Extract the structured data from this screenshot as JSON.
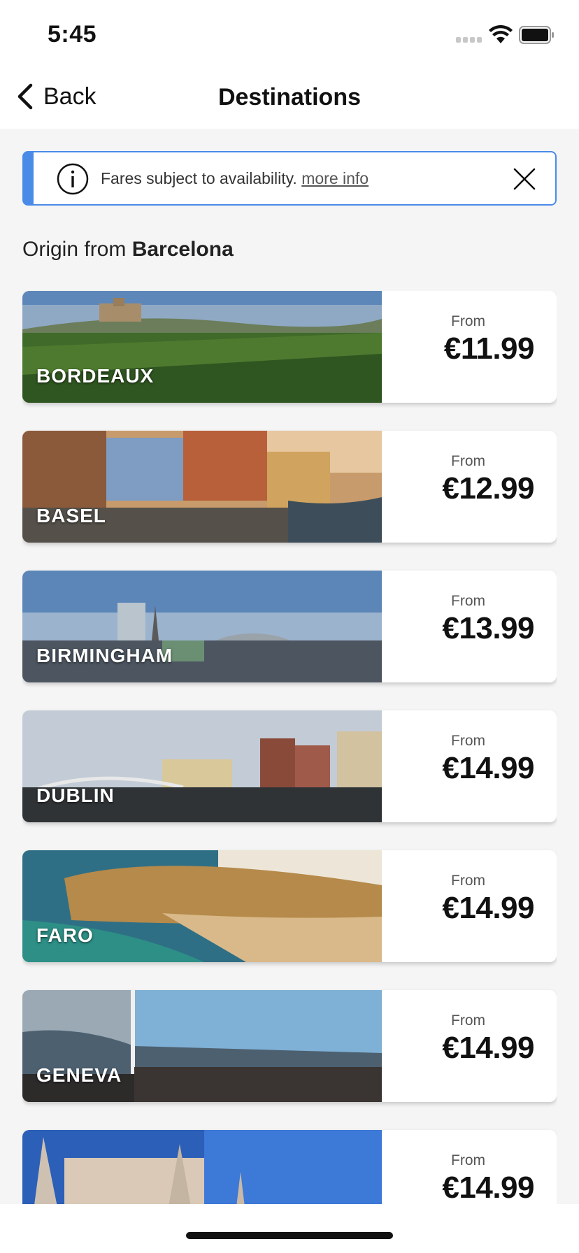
{
  "status_bar": {
    "time": "5:45"
  },
  "nav": {
    "back_label": "Back",
    "title": "Destinations"
  },
  "banner": {
    "text": "Fares subject to availability.",
    "link": "more info",
    "accent_color": "#4a8be8"
  },
  "origin": {
    "prefix": "Origin from",
    "city": "Barcelona"
  },
  "destinations": [
    {
      "city": "BORDEAUX",
      "from": "From",
      "price": "€11.99"
    },
    {
      "city": "BASEL",
      "from": "From",
      "price": "€12.99"
    },
    {
      "city": "BIRMINGHAM",
      "from": "From",
      "price": "€13.99"
    },
    {
      "city": "DUBLIN",
      "from": "From",
      "price": "€14.99"
    },
    {
      "city": "FARO",
      "from": "From",
      "price": "€14.99"
    },
    {
      "city": "GENEVA",
      "from": "From",
      "price": "€14.99"
    },
    {
      "city": "",
      "from": "From",
      "price": "€14.99"
    }
  ]
}
